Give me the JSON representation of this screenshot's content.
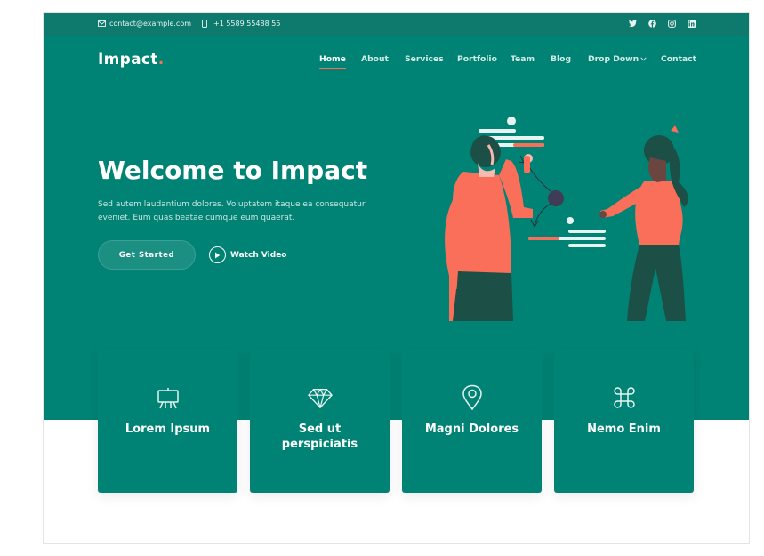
{
  "topbar": {
    "email": "contact@example.com",
    "phone": "+1 5589 55488 55",
    "socials": [
      "twitter-icon",
      "facebook-icon",
      "instagram-icon",
      "linkedin-icon"
    ]
  },
  "header": {
    "logo_text": "Impact",
    "logo_dot": ".",
    "nav": [
      "Home",
      "About",
      "Services",
      "Portfolio",
      "Team",
      "Blog",
      "Drop Down",
      "Contact"
    ]
  },
  "hero": {
    "title": "Welcome to Impact",
    "lead": "Sed autem laudantium dolores. Voluptatem itaque ea consequatur eveniet. Eum quas beatae cumque eum quaerat.",
    "cta_label": "Get Started",
    "video_label": "Watch Video"
  },
  "cards": [
    {
      "title": "Lorem Ipsum",
      "icon": "easel-icon"
    },
    {
      "title": "Sed ut perspiciatis",
      "icon": "gem-icon"
    },
    {
      "title": "Magni Dolores",
      "icon": "map-pin-icon"
    },
    {
      "title": "Nemo Enim",
      "icon": "command-icon"
    }
  ],
  "colors": {
    "primary": "#008374",
    "topbar": "#0d7a6d",
    "accent": "#f96f59"
  }
}
